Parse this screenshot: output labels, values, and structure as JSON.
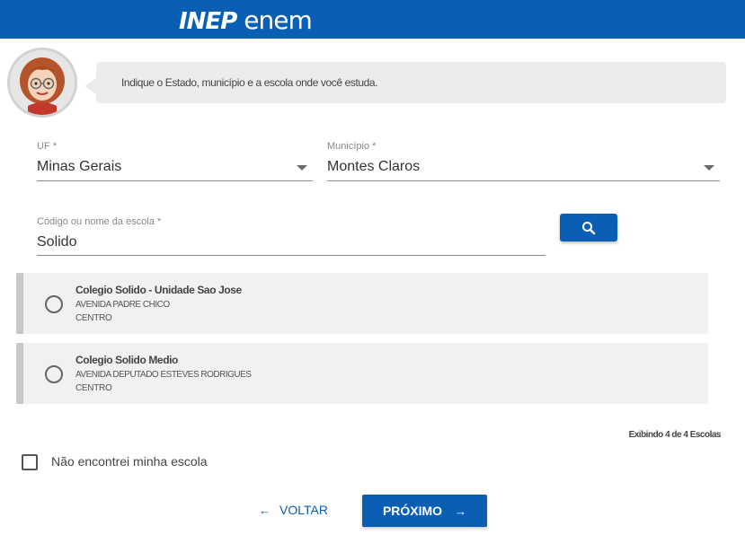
{
  "header": {
    "logo_inep": "INEP",
    "logo_enem": "enem",
    "bg_color": "#0a5fb4"
  },
  "assistant": {
    "avatar_icon": "assistant-avatar",
    "message": "Indique o Estado, município e a escola onde você estuda."
  },
  "form": {
    "uf": {
      "label": "UF *",
      "value": "Minas Gerais"
    },
    "municipio": {
      "label": "Município *",
      "value": "Montes Claros"
    },
    "escola": {
      "label": "Código ou nome da escola *",
      "value": "Solido"
    },
    "search_icon": "search-icon"
  },
  "results": [
    {
      "name": "Colegio Solido - Unidade Sao Jose",
      "address": "AVENIDA PADRE CHICO",
      "bairro": "CENTRO"
    },
    {
      "name": "Colegio Solido Medio",
      "address": "AVENIDA DEPUTADO ESTEVES RODRIGUES",
      "bairro": "CENTRO"
    }
  ],
  "results_count": "Exibindo 4 de 4 Escolas",
  "not_found_label": "Não encontrei minha escola",
  "nav": {
    "back_label": "VOLTAR",
    "back_icon": "arrow-left-icon",
    "next_label": "PRÓXIMO",
    "next_icon": "arrow-right-icon"
  }
}
